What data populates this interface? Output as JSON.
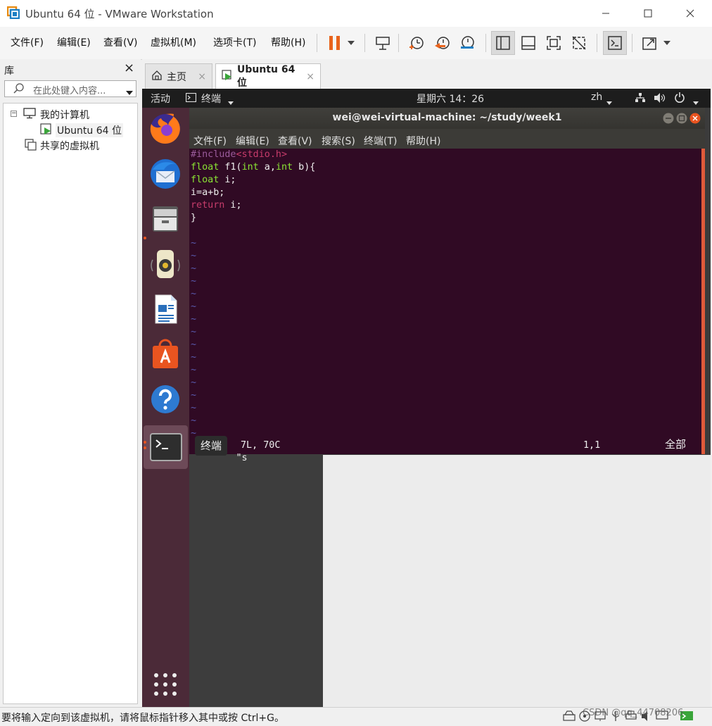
{
  "window": {
    "title": "Ubuntu 64 位 - VMware Workstation"
  },
  "menu": {
    "items": [
      "文件(F)",
      "编辑(E)",
      "查看(V)",
      "虚拟机(M)",
      "选项卡(T)",
      "帮助(H)"
    ]
  },
  "toolbar": {
    "icons": [
      "pause-icon",
      "dropdown-icon",
      "send-ctrl-alt-del-icon",
      "snapshot-icon",
      "revert-snapshot-icon",
      "snapshot-manager-icon",
      "library-view-icon",
      "thumbnail-view-icon",
      "fullscreen-icon",
      "unity-icon",
      "console-icon",
      "stretch-icon",
      "dropdown-icon"
    ]
  },
  "library": {
    "title": "库",
    "close_label": "×",
    "search_placeholder": "在此处键入内容...",
    "tree": {
      "root": "我的计算机",
      "vm": "Ubuntu 64 位",
      "shared": "共享的虚拟机"
    }
  },
  "tabs": [
    {
      "label": "主页",
      "active": false
    },
    {
      "label": "Ubuntu 64 位",
      "active": true
    }
  ],
  "ubuntu": {
    "activities": "活动",
    "app_menu": "终端",
    "clock": "星期六 14：26",
    "input_method": "zh",
    "dock_tooltip": "终端"
  },
  "terminal": {
    "title": "wei@wei-virtual-machine: ~/study/week1",
    "menu": [
      "文件(F)",
      "编辑(E)",
      "查看(V)",
      "搜索(S)",
      "终端(T)",
      "帮助(H)"
    ],
    "code": [
      [
        {
          "t": "#include",
          "c": "pp"
        },
        {
          "t": "<stdio.h>",
          "c": "str"
        }
      ],
      [
        {
          "t": "float",
          "c": "kw"
        },
        {
          "t": " f1(",
          "c": ""
        },
        {
          "t": "int",
          "c": "kw"
        },
        {
          "t": " a,",
          "c": ""
        },
        {
          "t": "int",
          "c": "kw"
        },
        {
          "t": " b){",
          "c": ""
        }
      ],
      [
        {
          "t": "float",
          "c": "kw"
        },
        {
          "t": " i;",
          "c": ""
        }
      ],
      [
        {
          "t": "i=a+b;",
          "c": ""
        }
      ],
      [
        {
          "t": "return",
          "c": "kw2"
        },
        {
          "t": " i;",
          "c": ""
        }
      ],
      [
        {
          "t": "}",
          "c": ""
        }
      ]
    ],
    "tilde_count": 16,
    "status_file": "\"s",
    "status_info": "7L, 70C",
    "status_pos": "1,1",
    "status_all": "全部"
  },
  "statusbar": {
    "message": "要将输入定向到该虚拟机，请将鼠标指针移入其中或按 Ctrl+G。",
    "watermark": "CSDN @qq_44708206"
  }
}
